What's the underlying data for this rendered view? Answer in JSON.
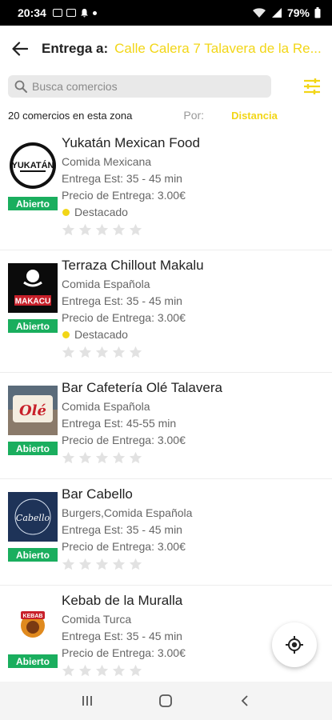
{
  "status": {
    "time": "20:34",
    "battery": "79%"
  },
  "header": {
    "label": "Entrega a:",
    "address": "Calle Calera 7 Talavera de la Re..."
  },
  "search": {
    "placeholder": "Busca comercios"
  },
  "summary": {
    "count_text": "20 comercios en esta zona",
    "sort_label": "Por:",
    "sort_value": "Distancia"
  },
  "colors": {
    "accent": "#f2d617",
    "open_badge": "#1aae5e"
  },
  "restaurants": [
    {
      "name": "Yukatán Mexican Food",
      "category": "Comida Mexicana",
      "eta": "Entrega Est: 35 - 45 min",
      "fee": "Precio de Entrega: 3.00€",
      "status": "Abierto",
      "featured": "Destacado",
      "logo_icon": "yukatan-logo",
      "logo_text": "YUKATÁN"
    },
    {
      "name": "Terraza Chillout Makalu",
      "category": "Comida Española",
      "eta": "Entrega Est: 35 - 45 min",
      "fee": "Precio de Entrega: 3.00€",
      "status": "Abierto",
      "featured": "Destacado",
      "logo_icon": "makalu-logo",
      "logo_text": "MAKACU"
    },
    {
      "name": "Bar Cafetería Olé Talavera",
      "category": "Comida Española",
      "eta": "Entrega Est: 45-55 min",
      "fee": "Precio de Entrega: 3.00€",
      "status": "Abierto",
      "featured": "",
      "logo_icon": "ole-logo",
      "logo_text": "Olé"
    },
    {
      "name": "Bar Cabello",
      "category": "Burgers,Comida Española",
      "eta": "Entrega Est: 35 - 45 min",
      "fee": "Precio de Entrega: 3.00€",
      "status": "Abierto",
      "featured": "",
      "logo_icon": "cabello-logo",
      "logo_text": "Cabello"
    },
    {
      "name": "Kebab de la Muralla",
      "category": "Comida Turca",
      "eta": "Entrega Est: 35 - 45 min",
      "fee": "Precio de Entrega: 3.00€",
      "status": "Abierto",
      "featured": "",
      "logo_icon": "kebab-logo",
      "logo_text": "KEBAB"
    }
  ]
}
